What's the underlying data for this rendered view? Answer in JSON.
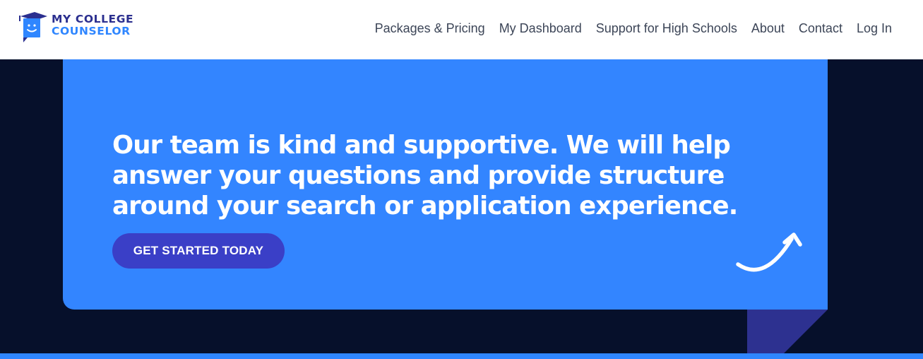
{
  "brand": {
    "line1": "MY COLLEGE",
    "line2": "COUNSELOR",
    "colors": {
      "navy": "#2b2f8f",
      "blue": "#2f86ff"
    }
  },
  "nav": {
    "items": [
      {
        "label": "Packages & Pricing"
      },
      {
        "label": "My Dashboard"
      },
      {
        "label": "Support for High Schools"
      },
      {
        "label": "About"
      },
      {
        "label": "Contact"
      },
      {
        "label": "Log In"
      }
    ]
  },
  "hero": {
    "headline": "Our team is kind and supportive. We will help answer your questions and provide structure around your search or application experience.",
    "cta_label": "GET STARTED TODAY",
    "colors": {
      "background": "#06102b",
      "card": "#3385ff",
      "button": "#3a3fc7",
      "fold": "#2d3190"
    },
    "decoration": "curved-arrow-icon"
  }
}
